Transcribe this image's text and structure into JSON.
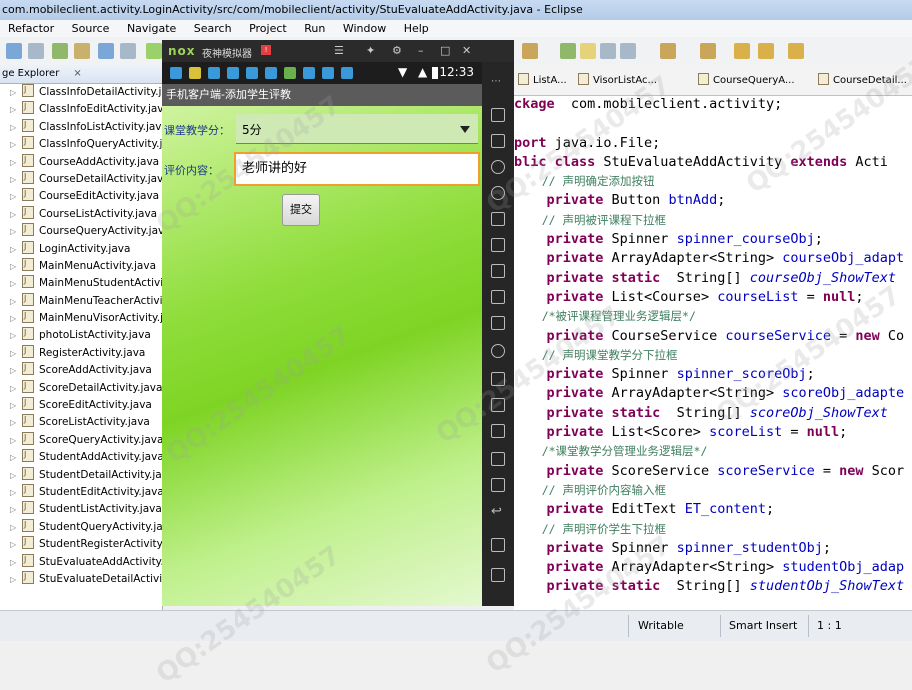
{
  "window": {
    "title": "com.mobileclient.activity.LoginActivity/src/com/mobileclient/activity/StuEvaluateAddActivity.java - Eclipse"
  },
  "menu": [
    "Refactor",
    "Source",
    "Navigate",
    "Search",
    "Project",
    "Run",
    "Window",
    "Help"
  ],
  "explorer": {
    "tab_label": "ge Explorer",
    "close_glyph": "⨯",
    "files": [
      "ClassInfoDetailActivity.java",
      "ClassInfoEditActivity.java",
      "ClassInfoListActivity.java",
      "ClassInfoQueryActivity.java",
      "CourseAddActivity.java",
      "CourseDetailActivity.java",
      "CourseEditActivity.java",
      "CourseListActivity.java",
      "CourseQueryActivity.java",
      "LoginActivity.java",
      "MainMenuActivity.java",
      "MainMenuStudentActivity.java",
      "MainMenuTeacherActivity.java",
      "MainMenuVisorActivity.java",
      "photoListActivity.java",
      "RegisterActivity.java",
      "ScoreAddActivity.java",
      "ScoreDetailActivity.java",
      "ScoreEditActivity.java",
      "ScoreListActivity.java",
      "ScoreQueryActivity.java",
      "StudentAddActivity.java",
      "StudentDetailActivity.java",
      "StudentEditActivity.java",
      "StudentListActivity.java",
      "StudentQueryActivity.java",
      "StudentRegisterActivity.java",
      "StuEvaluateAddActivity.java",
      "StuEvaluateDetailActivity.java"
    ]
  },
  "emulator": {
    "logo": "nox",
    "name": "夜神模拟器",
    "badge": "!",
    "controls": [
      "☰",
      "✦",
      "⚙",
      "–",
      "□",
      "✕"
    ],
    "clock": "12:33",
    "status_icons_colors": [
      "#3a9ad9",
      "#d9c23a",
      "#3a9ad9",
      "#3a9ad9",
      "#3a9ad9",
      "#3a9ad9",
      "#6ab04c",
      "#3a9ad9",
      "#3a9ad9",
      "#3a9ad9"
    ],
    "app": {
      "title": "手机客户端-添加学生评教",
      "score_label": "课堂教学分：",
      "score_value": "5分",
      "content_label": "评价内容：",
      "content_value": "老师讲的好",
      "submit_label": "提交"
    }
  },
  "editor": {
    "tabs": [
      "ListA...",
      "VisorListAc...",
      "CourseQueryA...",
      "CourseDetail..."
    ],
    "code": [
      [
        [
          "kw",
          "ckage"
        ],
        [
          "",
          "  com.mobileclient.activity;"
        ]
      ],
      [
        [
          "",
          ""
        ]
      ],
      [
        [
          "kw",
          "port"
        ],
        [
          "",
          " java.io.File;"
        ]
      ],
      [
        [
          "kw",
          "blic class"
        ],
        [
          "",
          " StuEvaluateAddActivity "
        ],
        [
          "kw",
          "extends"
        ],
        [
          "",
          " Acti"
        ]
      ],
      [
        [
          "cm",
          "    // 声明确定添加按钮"
        ]
      ],
      [
        [
          "",
          ""
        ],
        [
          "kw",
          "    private"
        ],
        [
          "",
          " Button "
        ],
        [
          "fd",
          "btnAdd"
        ],
        [
          "",
          ";"
        ]
      ],
      [
        [
          "cm",
          "    // 声明被评课程下拉框"
        ]
      ],
      [
        [
          "kw",
          "    private"
        ],
        [
          "",
          " Spinner "
        ],
        [
          "fd",
          "spinner_courseObj"
        ],
        [
          "",
          ";"
        ]
      ],
      [
        [
          "kw",
          "    private"
        ],
        [
          "",
          " ArrayAdapter<String> "
        ],
        [
          "fd",
          "courseObj_adapt"
        ]
      ],
      [
        [
          "kw",
          "    private static"
        ],
        [
          "",
          "  String[] "
        ],
        [
          "it",
          "courseObj_ShowText"
        ]
      ],
      [
        [
          "kw",
          "    private"
        ],
        [
          "",
          " List<Course> "
        ],
        [
          "fd",
          "courseList"
        ],
        [
          "",
          " = "
        ],
        [
          "kw",
          "null"
        ],
        [
          "",
          ";"
        ]
      ],
      [
        [
          "cm",
          "    /*被评课程管理业务逻辑层*/"
        ]
      ],
      [
        [
          "kw",
          "    private"
        ],
        [
          "",
          " CourseService "
        ],
        [
          "fd",
          "courseService"
        ],
        [
          "",
          " = "
        ],
        [
          "kw",
          "new"
        ],
        [
          "",
          " Co"
        ]
      ],
      [
        [
          "cm",
          "    // 声明课堂教学分下拉框"
        ]
      ],
      [
        [
          "kw",
          "    private"
        ],
        [
          "",
          " Spinner "
        ],
        [
          "fd",
          "spinner_scoreObj"
        ],
        [
          "",
          ";"
        ]
      ],
      [
        [
          "kw",
          "    private"
        ],
        [
          "",
          " ArrayAdapter<String> "
        ],
        [
          "fd",
          "scoreObj_adapte"
        ]
      ],
      [
        [
          "kw",
          "    private static"
        ],
        [
          "",
          "  String[] "
        ],
        [
          "it",
          "scoreObj_ShowText"
        ]
      ],
      [
        [
          "kw",
          "    private"
        ],
        [
          "",
          " List<Score> "
        ],
        [
          "fd",
          "scoreList"
        ],
        [
          "",
          " = "
        ],
        [
          "kw",
          "null"
        ],
        [
          "",
          ";"
        ]
      ],
      [
        [
          "cm",
          "    /*课堂教学分管理业务逻辑层*/"
        ]
      ],
      [
        [
          "kw",
          "    private"
        ],
        [
          "",
          " ScoreService "
        ],
        [
          "fd",
          "scoreService"
        ],
        [
          "",
          " = "
        ],
        [
          "kw",
          "new"
        ],
        [
          "",
          " Scor"
        ]
      ],
      [
        [
          "cm",
          "    // 声明评价内容输入框"
        ]
      ],
      [
        [
          "kw",
          "    private"
        ],
        [
          "",
          " EditText "
        ],
        [
          "fd",
          "ET_content"
        ],
        [
          "",
          ";"
        ]
      ],
      [
        [
          "cm",
          "    // 声明评价学生下拉框"
        ]
      ],
      [
        [
          "kw",
          "    private"
        ],
        [
          "",
          " Spinner "
        ],
        [
          "fd",
          "spinner_studentObj"
        ],
        [
          "",
          ";"
        ]
      ],
      [
        [
          "kw",
          "    private"
        ],
        [
          "",
          " ArrayAdapter<String> "
        ],
        [
          "fd",
          "studentObj_adap"
        ]
      ],
      [
        [
          "kw",
          "    private static"
        ],
        [
          "",
          "  String[] "
        ],
        [
          "it",
          "studentObj_ShowText"
        ]
      ]
    ]
  },
  "status": {
    "writable": "Writable",
    "insert": "Smart Insert",
    "position": "1 : 1"
  },
  "watermark": "QQ:254540457"
}
